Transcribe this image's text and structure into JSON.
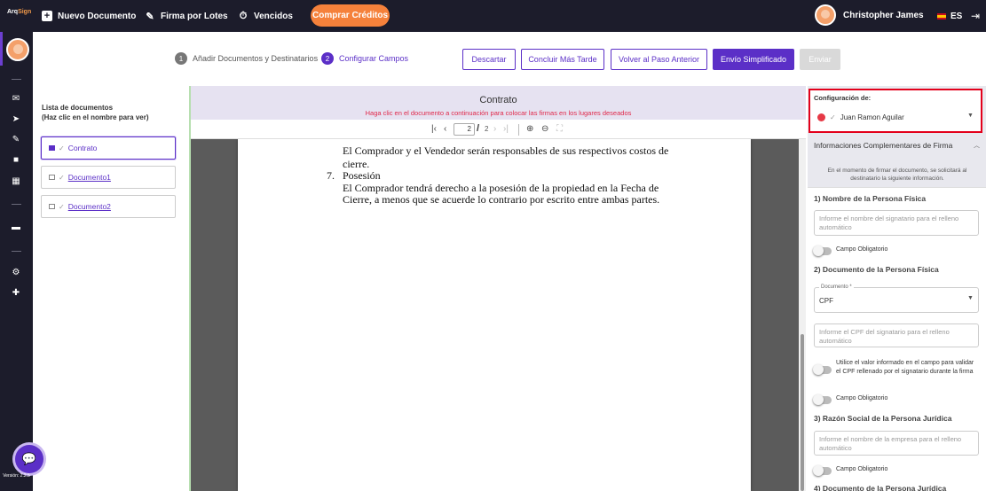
{
  "topbar": {
    "logo_prefix": "Arq",
    "logo_suffix": "Sign",
    "new_document": "Nuevo Documento",
    "batch_sign": "Firma por Lotes",
    "expired": "Vencidos",
    "buy_credits": "Comprar Créditos",
    "user_name": "Christopher James",
    "language": "ES"
  },
  "sidebar": {
    "version": "Versión: 2.2.5"
  },
  "stepper": {
    "step1_num": "1",
    "step1_label": "Añadir Documentos y Destinatarios",
    "step2_num": "2",
    "step2_label": "Configurar Campos"
  },
  "actions": {
    "discard": "Descartar",
    "finish_later": "Concluir Más Tarde",
    "back": "Volver al Paso Anterior",
    "simplified": "Envío Simplificado",
    "send": "Enviar"
  },
  "doc_list": {
    "title_line1": "Lista de documentos",
    "title_line2": "(Haz clic en el nombre para ver)",
    "items": [
      "Contrato",
      "Documento1",
      "Documento2"
    ]
  },
  "viewer": {
    "title": "Contrato",
    "hint": "Haga clic en el documento a continuación para colocar las firmas en los lugares deseados",
    "current_page": "2",
    "total_pages": "2",
    "separator": "/",
    "lines": [
      "El Comprador y el Vendedor serán responsables de sus respectivos costos de",
      "cierre.",
      "Posesión",
      "El Comprador tendrá derecho a la posesión de la propiedad en la Fecha de",
      "Cierre, a menos que se acuerde lo contrario por escrito entre ambas partes."
    ],
    "item_number": "7."
  },
  "config": {
    "label": "Configuración de:",
    "signer": "Juan Ramon Aguilar",
    "section_title": "Informaciones Complementares de Firma",
    "info": "En el momento de firmar el documento, se solicitará al destinatario la siguiente información.",
    "q1": "1) Nombre de la Persona Física",
    "q1_placeholder": "Informe el nombre del signatario para el relleno automático",
    "required": "Campo Obligatorio",
    "q2": "2) Documento de la Persona Física",
    "doc_label": "Documento *",
    "doc_value": "CPF",
    "q2_placeholder": "Informe el CPF del signatario para el relleno automático",
    "validate_text": "Utilice el valor informado en el campo para validar el CPF rellenado por el signatario durante la firma",
    "q3": "3) Razón Social de la Persona Jurídica",
    "q3_placeholder": "Informe el nombre de la empresa para el relleno automático",
    "q4_partial": "4) Documento de la Persona Jurídica"
  }
}
